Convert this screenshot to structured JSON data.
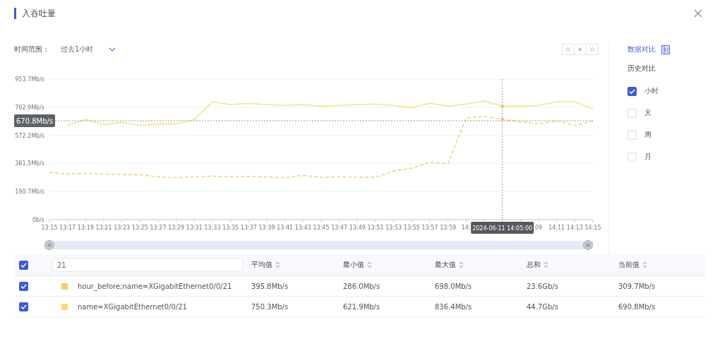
{
  "dialog": {
    "title": "入吞吐量"
  },
  "time_range": {
    "label": "时间范围：",
    "value": "过去1小时"
  },
  "compare": {
    "link": "数据对比",
    "heading": "历史对比",
    "options": [
      {
        "label": "小时",
        "checked": true
      },
      {
        "label": "天",
        "checked": false
      },
      {
        "label": "周",
        "checked": false
      },
      {
        "label": "月",
        "checked": false
      }
    ]
  },
  "chart": {
    "chart_data": {
      "type": "line",
      "grid": true,
      "x": [
        "13:15",
        "13:17",
        "13:19",
        "13:21",
        "13:23",
        "13:25",
        "13:27",
        "13:29",
        "13:31",
        "13:33",
        "13:35",
        "13:37",
        "13:39",
        "13:41",
        "13:43",
        "13:45",
        "13:47",
        "13:49",
        "13:51",
        "13:53",
        "13:55",
        "13:57",
        "13:59",
        "14:",
        null,
        null,
        null,
        "09",
        "14:11",
        "14:13",
        "14:15"
      ],
      "series": [
        {
          "color": "#f2d675",
          "line_style": "dashed",
          "values": [
            320,
            310,
            315,
            310,
            305,
            305,
            290,
            285,
            290,
            295,
            290,
            292,
            290,
            285,
            300,
            287,
            290,
            288,
            288,
            330,
            350,
            390,
            380,
            690,
            700,
            680,
            665,
            650,
            670,
            640,
            670
          ]
        },
        {
          "color": "#f5e48c",
          "line_style": "solid",
          "values": [
            null,
            640,
            680,
            645,
            660,
            640,
            650,
            650,
            680,
            800,
            780,
            790,
            780,
            775,
            780,
            770,
            775,
            780,
            785,
            775,
            760,
            790,
            770,
            785,
            805,
            770,
            770,
            775,
            800,
            800,
            750
          ]
        }
      ],
      "ylim": [
        0,
        953.7
      ],
      "yticks": [
        {
          "value": 0,
          "label": "0b/s"
        },
        {
          "value": 190.7,
          "label": "190.7Mb/s"
        },
        {
          "value": 381.5,
          "label": "381.5Mb/s"
        },
        {
          "value": 572.2,
          "label": "572.2Mb/s"
        },
        {
          "value": 762.9,
          "label": "762.9Mb/s"
        },
        {
          "value": 953.7,
          "label": "953.7Mb/s"
        }
      ],
      "ref_lines": [
        {
          "axis": "y",
          "value": 670.8,
          "label": "670.8Mb/s"
        }
      ]
    },
    "tooltip": {
      "label": "2024-06-11 14:05:00"
    }
  },
  "range": {
    "level": 1
  },
  "table": {
    "select_all": true,
    "search": {
      "value": "21"
    },
    "columns": [
      "平均值",
      "最小值",
      "最大值",
      "总和",
      "当前值"
    ],
    "rows": [
      {
        "checked": true,
        "color": "#f5cf6a",
        "name": "hour_before;name=XGigabitEthernet0/0/21",
        "cells": [
          "395.8Mb/s",
          "286.0Mb/s",
          "698.0Mb/s",
          "23.6Gb/s",
          "309.7Mb/s"
        ]
      },
      {
        "checked": true,
        "color": "#f7dc78",
        "name": "name=XGigabitEthernet0/0/21",
        "cells": [
          "750.3Mb/s",
          "621.9Mb/s",
          "836.4Mb/s",
          "44.7Gb/s",
          "690.8Mb/s"
        ]
      }
    ]
  }
}
